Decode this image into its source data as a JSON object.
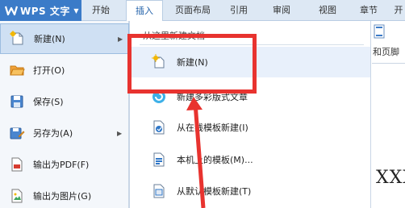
{
  "app": {
    "title": "WPS 文字"
  },
  "tabs": [
    {
      "label": "开始",
      "active": false
    },
    {
      "label": "插入",
      "active": true
    },
    {
      "label": "页面布局",
      "active": false
    },
    {
      "label": "引用",
      "active": false
    },
    {
      "label": "审阅",
      "active": false
    },
    {
      "label": "视图",
      "active": false
    },
    {
      "label": "章节",
      "active": false
    },
    {
      "label": "开",
      "active": false
    }
  ],
  "file_menu": {
    "items": [
      {
        "label": "新建(N)",
        "icon": "new-document-icon",
        "highlighted": true,
        "has_submenu": true
      },
      {
        "label": "打开(O)",
        "icon": "open-folder-icon"
      },
      {
        "label": "保存(S)",
        "icon": "save-icon"
      },
      {
        "label": "另存为(A)",
        "icon": "save-as-icon",
        "has_submenu": true
      },
      {
        "label": "输出为PDF(F)",
        "icon": "export-pdf-icon"
      },
      {
        "label": "输出为图片(G)",
        "icon": "export-image-icon"
      }
    ]
  },
  "new_submenu": {
    "header": "从这里新建文档",
    "items": [
      {
        "label": "新建(N)",
        "icon": "new-document-icon",
        "highlighted": true
      },
      {
        "label": "新建多彩版式文章",
        "icon": "colorful-article-icon"
      },
      {
        "label": "从在线模板新建(I)",
        "icon": "online-template-icon"
      },
      {
        "label": "本机上的模板(M)...",
        "icon": "local-template-icon"
      },
      {
        "label": "从默认模板新建(T)",
        "icon": "default-template-icon"
      }
    ]
  },
  "ribbon_partial": {
    "label": "和页脚"
  },
  "document": {
    "text": "XXX"
  },
  "colors": {
    "accent": "#3b7bc8",
    "annotation": "#e8332f",
    "highlight": "#cfe0f3"
  }
}
